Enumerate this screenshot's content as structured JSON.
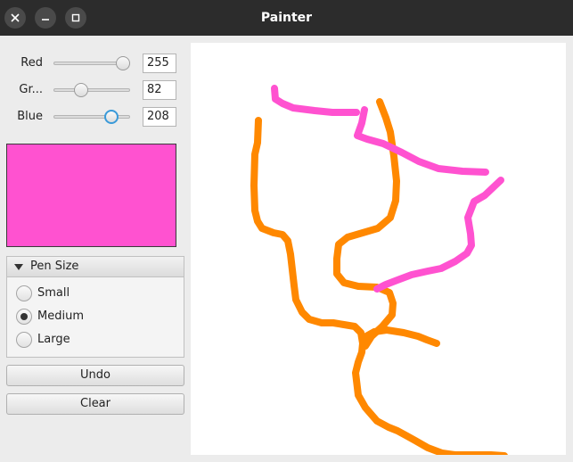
{
  "window": {
    "title": "Painter",
    "buttons": {
      "close": "close-icon",
      "minimize": "minimize-icon",
      "maximize": "maximize-icon"
    }
  },
  "sliders": [
    {
      "label": "Red",
      "value": "255",
      "level": 1.0,
      "focused": false
    },
    {
      "label": "Gr...",
      "value": "82",
      "level": 0.3216,
      "focused": false
    },
    {
      "label": "Blue",
      "value": "208",
      "level": 0.8157,
      "focused": true
    }
  ],
  "swatch": {
    "color": "#ff52d0"
  },
  "pen_size": {
    "title": "Pen Size",
    "options": [
      {
        "label": "Small",
        "selected": false
      },
      {
        "label": "Medium",
        "selected": true
      },
      {
        "label": "Large",
        "selected": false
      }
    ]
  },
  "actions": {
    "undo_label": "Undo",
    "clear_label": "Clear"
  },
  "colors": {
    "orange_stroke": "#ff8800",
    "pink_stroke": "#ff52d0",
    "titlebar": "#2c2c2c"
  }
}
